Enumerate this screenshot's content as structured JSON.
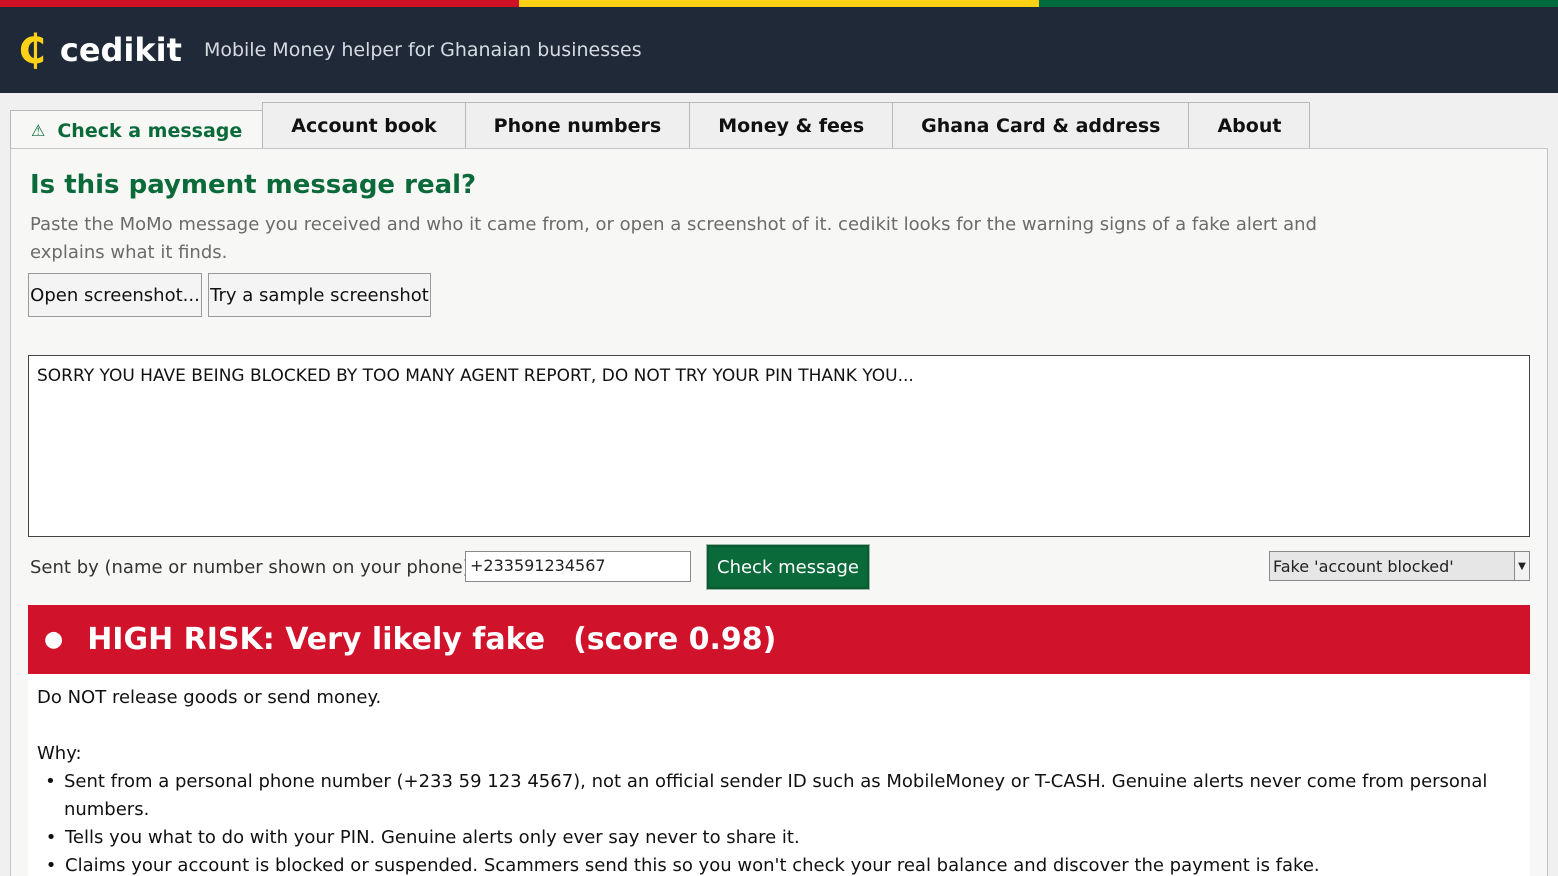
{
  "colors": {
    "flag_red": "#ce1126",
    "flag_gold": "#fcd116",
    "flag_green": "#006b3f",
    "header_bg": "#1f2937",
    "brand_green": "#0b6a3a",
    "risk_red": "#d0122b",
    "logo_gold": "#fcd116"
  },
  "header": {
    "logo_icon": "₵",
    "app_name": "cedikit",
    "tagline": "Mobile Money helper for Ghanaian businesses"
  },
  "tabs": [
    {
      "label": "Check a message",
      "icon": "warning-icon",
      "icon_glyph": "⚠",
      "active": true
    },
    {
      "label": "Account book"
    },
    {
      "label": "Phone numbers"
    },
    {
      "label": "Money & fees"
    },
    {
      "label": "Ghana Card & address"
    },
    {
      "label": "About"
    }
  ],
  "check": {
    "title": "Is this payment message real?",
    "intro": "Paste the MoMo message you received and who it came from, or open a screenshot of it. cedikit looks for the warning signs of a fake alert and explains what it finds.",
    "open_screenshot_label": "Open screenshot...",
    "sample_screenshot_label": "Try a sample screenshot",
    "message_text": "SORRY YOU HAVE BEING BLOCKED BY TOO MANY AGENT REPORT, DO NOT TRY YOUR PIN THANK YOU...",
    "sender_label": "Sent by (name or number shown on your phone):",
    "sender_value": "+233591234567",
    "check_button_label": "Check message",
    "sample_selected": "Fake 'account blocked'"
  },
  "result": {
    "risk_dot": "●",
    "risk_label": "HIGH RISK: Very likely fake",
    "score_text": "(score 0.98)",
    "advice": "Do NOT release goods or send money.",
    "why_label": "Why:",
    "reasons": [
      "Sent from a personal phone number (+233 59 123 4567), not an official sender ID such as MobileMoney or T-CASH. Genuine alerts never come from personal numbers.",
      "Tells you what to do with your PIN. Genuine alerts only ever say never to share it.",
      "Claims your account is blocked or suspended. Scammers send this so you won't check your real balance and discover the payment is fake."
    ]
  }
}
